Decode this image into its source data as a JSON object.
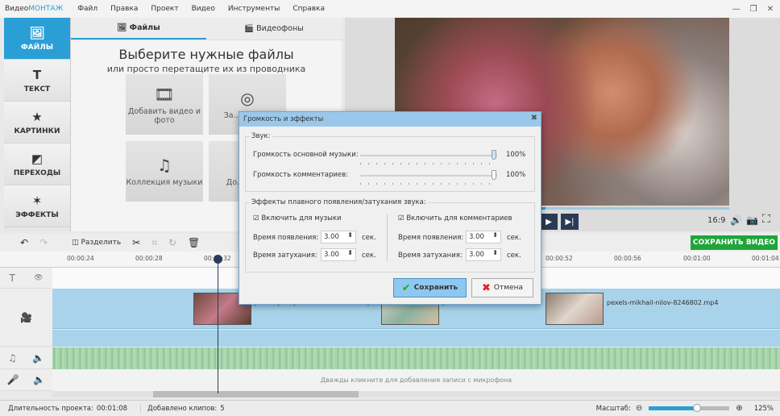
{
  "app": {
    "logo_prefix": "Видео",
    "logo_brand": "МОНТАЖ"
  },
  "menu": [
    "Файл",
    "Правка",
    "Проект",
    "Видео",
    "Инструменты",
    "Справка"
  ],
  "window_controls": {
    "minimize": "—",
    "restore": "❐",
    "close": "✕"
  },
  "sidebar": [
    {
      "label": "ФАЙЛЫ",
      "icon": "🖼"
    },
    {
      "label": "ТЕКСТ",
      "icon": "T"
    },
    {
      "label": "КАРТИНКИ",
      "icon": "★"
    },
    {
      "label": "ПЕРЕХОДЫ",
      "icon": "◩"
    },
    {
      "label": "ЭФФЕКТЫ",
      "icon": "✶"
    }
  ],
  "files": {
    "tabs": [
      "Файлы",
      "Видеофоны"
    ],
    "title": "Выберите нужные файлы",
    "subtitle": "или просто перетащите их из проводника",
    "tiles": [
      {
        "label": "Добавить видео и фото",
        "icon": "🎞"
      },
      {
        "label": "За... с веб...",
        "icon": "◎"
      },
      {
        "label": "Коллекция музыки",
        "icon": "♫"
      },
      {
        "label": "До... ауд...",
        "icon": "♪"
      }
    ]
  },
  "preview": {
    "aspect": "16:9",
    "progress": 0.45
  },
  "toolbar": {
    "split": "Разделить",
    "save_video": "СОХРАНИТЬ ВИДЕО"
  },
  "ruler": [
    "00:00:24",
    "00:00:28",
    "00:00:32",
    "00:00:52",
    "00:00:56",
    "00:01:00",
    "00:01:04"
  ],
  "clips": [
    "pexels-pnw-production-8997513.mp",
    "pexels-anna-nekrashevich-8",
    "pexels-mikhail-nilov-8246802.mp4"
  ],
  "mic_hint": "Дважды кликните для добавления записи с микрофона",
  "status": {
    "duration_label": "Длительность проекта:",
    "duration": "00:01:08",
    "clips_label": "Добавлено клипов:",
    "clips": "5",
    "zoom_label": "Масштаб:",
    "zoom": "125%",
    "zoom_fraction": 0.6
  },
  "dialog": {
    "title": "Громкость и эффекты",
    "sound_group": "Звук:",
    "music_volume_label": "Громкость основной музыки:",
    "music_volume": "100%",
    "comments_volume_label": "Громкость комментариев:",
    "comments_volume": "100%",
    "fade_group": "Эффекты плавного появления/затухания звука:",
    "music": {
      "enable": "Включить для музыки",
      "checked": true,
      "fade_in_label": "Время появления:",
      "fade_in": "3.00",
      "fade_out_label": "Время затухания:",
      "fade_out": "3.00",
      "unit": "сек."
    },
    "comments": {
      "enable": "Включить для комментариев",
      "checked": true,
      "fade_in_label": "Время появления:",
      "fade_in": "3.00",
      "fade_out_label": "Время затухания:",
      "fade_out": "3.00",
      "unit": "сек."
    },
    "save": "Сохранить",
    "cancel": "Отмена"
  }
}
